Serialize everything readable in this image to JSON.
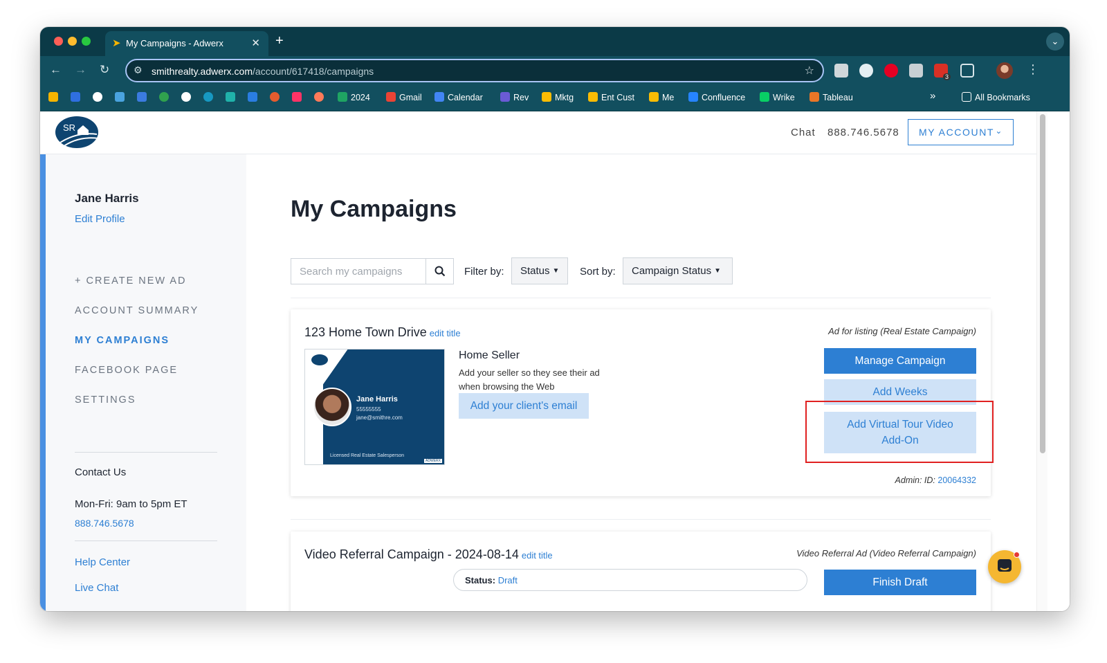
{
  "browser": {
    "tab_title": "My Campaigns - Adwerx",
    "url_host": "smithrealty.adwerx.com",
    "url_path": "/account/617418/campaigns",
    "extension_badge": "3",
    "bookmarks": [
      "2024",
      "Gmail",
      "Calendar",
      "Rev",
      "Mktg",
      "Ent Cust",
      "Me",
      "Confluence",
      "Wrike",
      "Tableau"
    ],
    "all_bookmarks": "All Bookmarks",
    "more_bookmarks": "»"
  },
  "header": {
    "logo_text": "SR",
    "chat": "Chat",
    "phone": "888.746.5678",
    "my_account": "MY ACCOUNT"
  },
  "sidebar": {
    "user_name": "Jane Harris",
    "edit_profile": "Edit Profile",
    "nav": [
      "+ CREATE NEW AD",
      "ACCOUNT SUMMARY",
      "MY CAMPAIGNS",
      "FACEBOOK PAGE",
      "SETTINGS"
    ],
    "contact_title": "Contact Us",
    "hours": "Mon-Fri: 9am to 5pm ET",
    "contact_phone": "888.746.5678",
    "help_center": "Help Center",
    "live_chat": "Live Chat"
  },
  "main": {
    "title": "My Campaigns",
    "search_placeholder": "Search my campaigns",
    "filter_label": "Filter by:",
    "filter_value": "Status",
    "sort_label": "Sort by:",
    "sort_value": "Campaign Status"
  },
  "campaigns": [
    {
      "title": "123 Home Town Drive",
      "edit_title": "edit title",
      "type": "Ad for listing (Real Estate Campaign)",
      "ad_name": "Jane Harris",
      "ad_phone": "55555555",
      "ad_email": "jane@smithre.com",
      "ad_footer": "Licensed Real Estate Salesperson",
      "ad_brand": "ADWERX",
      "seller_title": "Home Seller",
      "seller_desc": "Add your seller so they see their ad when browsing the Web",
      "client_email_button": "Add your client's email",
      "manage_button": "Manage Campaign",
      "add_weeks_button": "Add Weeks",
      "virtual_tour_line1": "Add Virtual Tour Video",
      "virtual_tour_line2": "Add-On",
      "admin_label": "Admin: ID:",
      "admin_id": "20064332"
    },
    {
      "title": "Video Referral Campaign - 2024-08-14",
      "edit_title": "edit title",
      "type": "Video Referral Ad (Video Referral Campaign)",
      "status_label": "Status:",
      "status_value": "Draft",
      "finish_button": "Finish Draft"
    }
  ]
}
